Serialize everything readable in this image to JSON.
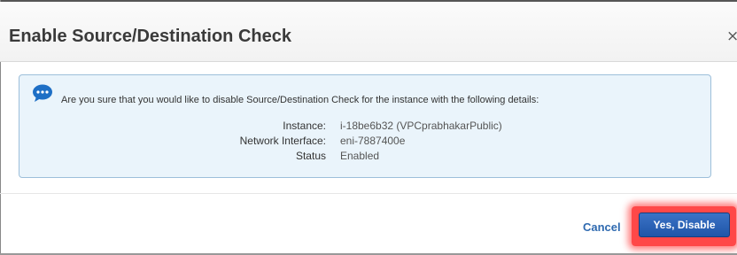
{
  "dialog": {
    "title": "Enable Source/Destination Check",
    "close_glyph": "×"
  },
  "message": {
    "icon": "speech-bubble-icon",
    "text": "Are you sure that you would like to disable Source/Destination Check for the instance with the following details:"
  },
  "details": [
    {
      "label": "Instance:",
      "value": "i-18be6b32 (VPCprabhakarPublic)"
    },
    {
      "label": "Network Interface:",
      "value": "eni-7887400e"
    },
    {
      "label": "Status",
      "value": "Enabled"
    }
  ],
  "actions": {
    "cancel_label": "Cancel",
    "confirm_label": "Yes, Disable"
  },
  "colors": {
    "info_background": "#eaf4fb",
    "info_border": "#9dbfda",
    "primary_button": "#1f55a8",
    "link": "#2f6ab0",
    "highlight": "#ff2828"
  }
}
